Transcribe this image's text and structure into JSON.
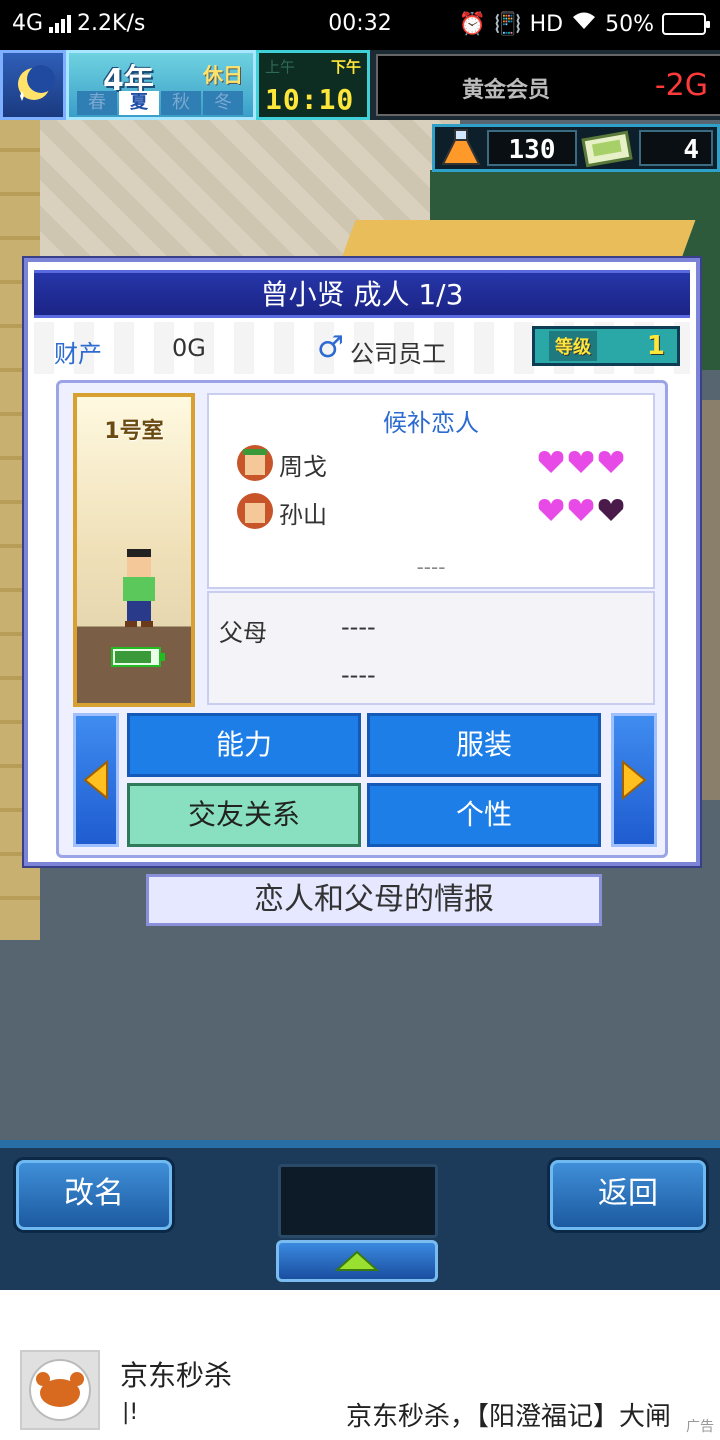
{
  "status_bar": {
    "network": "4G",
    "speed": "2.2K/s",
    "time": "00:32",
    "hd": "HD",
    "battery": "50%",
    "battery_level": 0.5
  },
  "hud": {
    "year": "4年",
    "holiday": "休日",
    "seasons": [
      "春",
      "夏",
      "秋",
      "冬"
    ],
    "active_season": "夏",
    "am": "上午",
    "pm": "下午",
    "clock": "10:10",
    "member_label": "黄金会员",
    "money": "-2G",
    "research_points": "130",
    "tickets": "4"
  },
  "dialog": {
    "title": "曾小贤 成人 1/3",
    "asset_label": "财产",
    "asset_value": "0G",
    "gender_symbol": "♂",
    "job": "公司员工",
    "level_label": "等级",
    "level_value": "1",
    "room": "1号室",
    "lovers_title": "候补恋人",
    "lovers": [
      {
        "name": "周戈",
        "hearts": 3
      },
      {
        "name": "孙山",
        "hearts": 2
      }
    ],
    "lovers_placeholder": "----",
    "parents_label": "父母",
    "parent_1": "----",
    "parent_2": "----",
    "tabs": [
      "能力",
      "服装",
      "交友关系",
      "个性"
    ],
    "active_tab": "交友关系"
  },
  "caption": "恋人和父母的情报",
  "bottom_bar": {
    "rename_label": "改名",
    "back_label": "返回"
  },
  "ad": {
    "title": "京东秒杀",
    "extra": "|!",
    "text": "京东秒杀，【阳澄福记】大闸",
    "tag": "广告"
  },
  "colors": {
    "heart_full": "#e84ae8",
    "heart_empty": "#4a1a4a",
    "title_blue": "#1b2486",
    "tab_blue": "#1e7ee8",
    "tab_active": "#88e0c0",
    "money_red": "#ff3a3a"
  }
}
